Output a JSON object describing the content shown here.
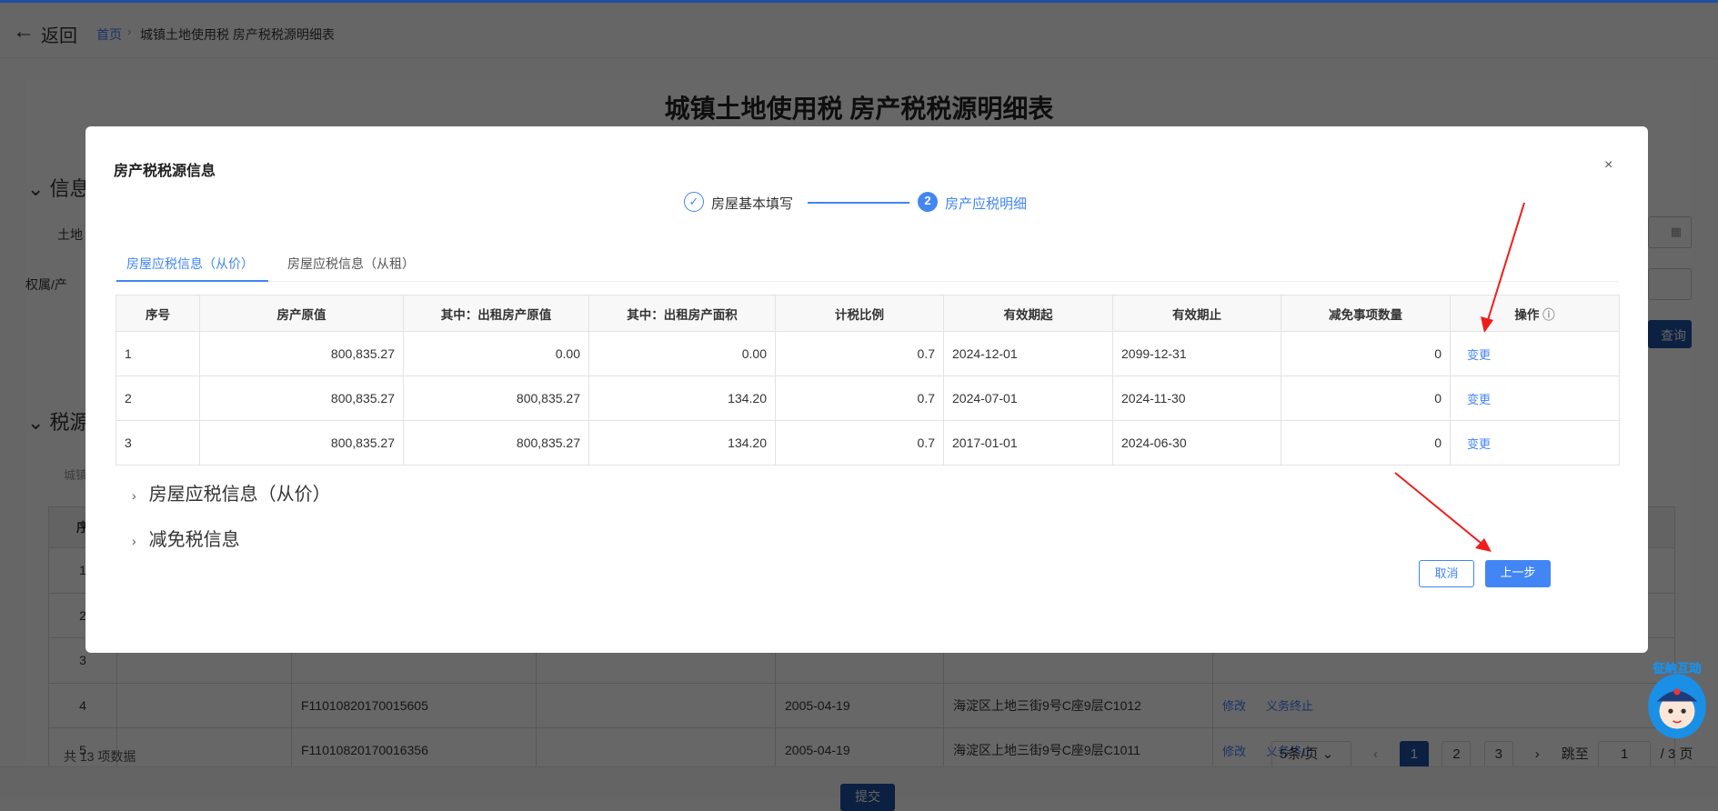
{
  "header": {
    "back_label": "返回",
    "breadcrumb_home": "首页",
    "breadcrumb_current": "城镇土地使用税 房产税税源明细表"
  },
  "page": {
    "title": "城镇土地使用税 房产税税源明细表",
    "section_info": "信息",
    "label_land": "土地",
    "label_owner": "权属/产",
    "query_button": "查询",
    "section_source": "税源",
    "sub_label": "城镇",
    "submit": "提交"
  },
  "bg_table": {
    "header_first": "序",
    "rows": [
      {
        "no": "1"
      },
      {
        "no": "2"
      },
      {
        "no": "3"
      },
      {
        "no": "4",
        "code": "F11010820170015605",
        "date": "2005-04-19",
        "address": "海淀区上地三街9号C座9层C1012",
        "op1": "修改",
        "op2": "义务终止"
      },
      {
        "no": "5",
        "code": "F11010820170016356",
        "date": "2005-04-19",
        "address": "海淀区上地三街9号C座9层C1011",
        "op1": "修改",
        "op2": "义务终止"
      }
    ]
  },
  "pagination": {
    "total": "共 13 项数据",
    "page_size": "5条/页",
    "pages": [
      "1",
      "2",
      "3"
    ],
    "jump_label": "跳至",
    "jump_value": "1",
    "total_pages": "/ 3 页"
  },
  "mascot": {
    "text": "征纳互动"
  },
  "modal": {
    "title": "房产税税源信息",
    "close": "×",
    "steps": [
      {
        "num": "✓",
        "label": "房屋基本填写"
      },
      {
        "num": "2",
        "label": "房产应税明细"
      }
    ],
    "tabs": [
      {
        "label": "房屋应税信息（从价）"
      },
      {
        "label": "房屋应税信息（从租）"
      }
    ],
    "columns": [
      "序号",
      "房产原值",
      "其中：出租房产原值",
      "其中：出租房产面积",
      "计税比例",
      "有效期起",
      "有效期止",
      "减免事项数量",
      "操作"
    ],
    "rows": [
      [
        "1",
        "800,835.27",
        "0.00",
        "0.00",
        "0.7",
        "2024-12-01",
        "2099-12-31",
        "0",
        "变更"
      ],
      [
        "2",
        "800,835.27",
        "800,835.27",
        "134.20",
        "0.7",
        "2024-07-01",
        "2024-11-30",
        "0",
        "变更"
      ],
      [
        "3",
        "800,835.27",
        "800,835.27",
        "134.20",
        "0.7",
        "2017-01-01",
        "2024-06-30",
        "0",
        "变更"
      ]
    ],
    "collapse": [
      "房屋应税信息（从价）",
      "减免税信息"
    ],
    "cancel": "取消",
    "prev": "上一步"
  },
  "colors": {
    "primary": "#4285f4",
    "nav": "#1f4fa3",
    "arrow": "#f01c1c"
  }
}
